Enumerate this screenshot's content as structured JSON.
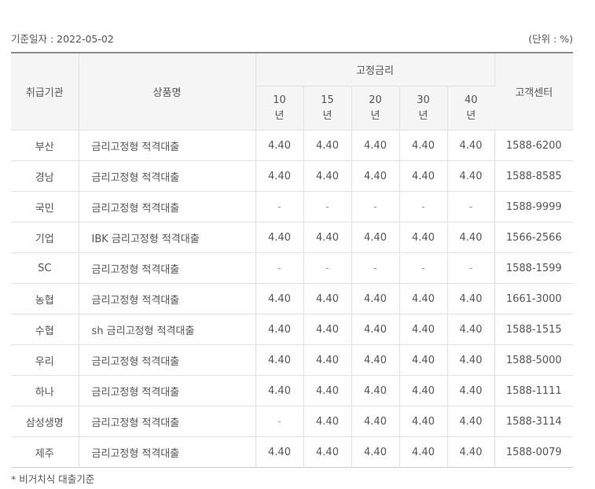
{
  "base_date": "기준일자 : 2022-05-02",
  "unit": "(단위 : %)",
  "headers": {
    "bank": "취급기관",
    "product": "상품명",
    "fixed_rate": "고정금리",
    "terms": [
      {
        "num": "10",
        "unit": "년"
      },
      {
        "num": "15",
        "unit": "년"
      },
      {
        "num": "20",
        "unit": "년"
      },
      {
        "num": "30",
        "unit": "년"
      },
      {
        "num": "40",
        "unit": "년"
      }
    ],
    "contact": "고객센터"
  },
  "rows": [
    {
      "bank": "부산",
      "product": "금리고정형 적격대출",
      "rates": [
        "4.40",
        "4.40",
        "4.40",
        "4.40",
        "4.40"
      ],
      "phone": "1588-6200"
    },
    {
      "bank": "경남",
      "product": "금리고정형 적격대출",
      "rates": [
        "4.40",
        "4.40",
        "4.40",
        "4.40",
        "4.40"
      ],
      "phone": "1588-8585"
    },
    {
      "bank": "국민",
      "product": "금리고정형 적격대출",
      "rates": [
        "-",
        "-",
        "-",
        "-",
        "-"
      ],
      "phone": "1588-9999"
    },
    {
      "bank": "기업",
      "product": "IBK 금리고정형 적격대출",
      "rates": [
        "4.40",
        "4.40",
        "4.40",
        "4.40",
        "4.40"
      ],
      "phone": "1566-2566"
    },
    {
      "bank": "SC",
      "product": "금리고정형 적격대출",
      "rates": [
        "-",
        "-",
        "-",
        "-",
        "-"
      ],
      "phone": "1588-1599"
    },
    {
      "bank": "농협",
      "product": "금리고정형 적격대출",
      "rates": [
        "4.40",
        "4.40",
        "4.40",
        "4.40",
        "4.40"
      ],
      "phone": "1661-3000"
    },
    {
      "bank": "수협",
      "product": "sh 금리고정형 적격대출",
      "rates": [
        "4.40",
        "4.40",
        "4.40",
        "4.40",
        "4.40"
      ],
      "phone": "1588-1515"
    },
    {
      "bank": "우리",
      "product": "금리고정형 적격대출",
      "rates": [
        "4.40",
        "4.40",
        "4.40",
        "4.40",
        "4.40"
      ],
      "phone": "1588-5000"
    },
    {
      "bank": "하나",
      "product": "금리고정형 적격대출",
      "rates": [
        "4.40",
        "4.40",
        "4.40",
        "4.40",
        "4.40"
      ],
      "phone": "1588-1111"
    },
    {
      "bank": "삼성생명",
      "product": "금리고정형 적격대출",
      "rates": [
        "-",
        "4.40",
        "4.40",
        "4.40",
        "4.40"
      ],
      "phone": "1588-3114"
    },
    {
      "bank": "제주",
      "product": "금리고정형 적격대출",
      "rates": [
        "4.40",
        "4.40",
        "4.40",
        "4.40",
        "4.40"
      ],
      "phone": "1588-0079"
    }
  ],
  "footnote": "* 비거치식 대출기준"
}
